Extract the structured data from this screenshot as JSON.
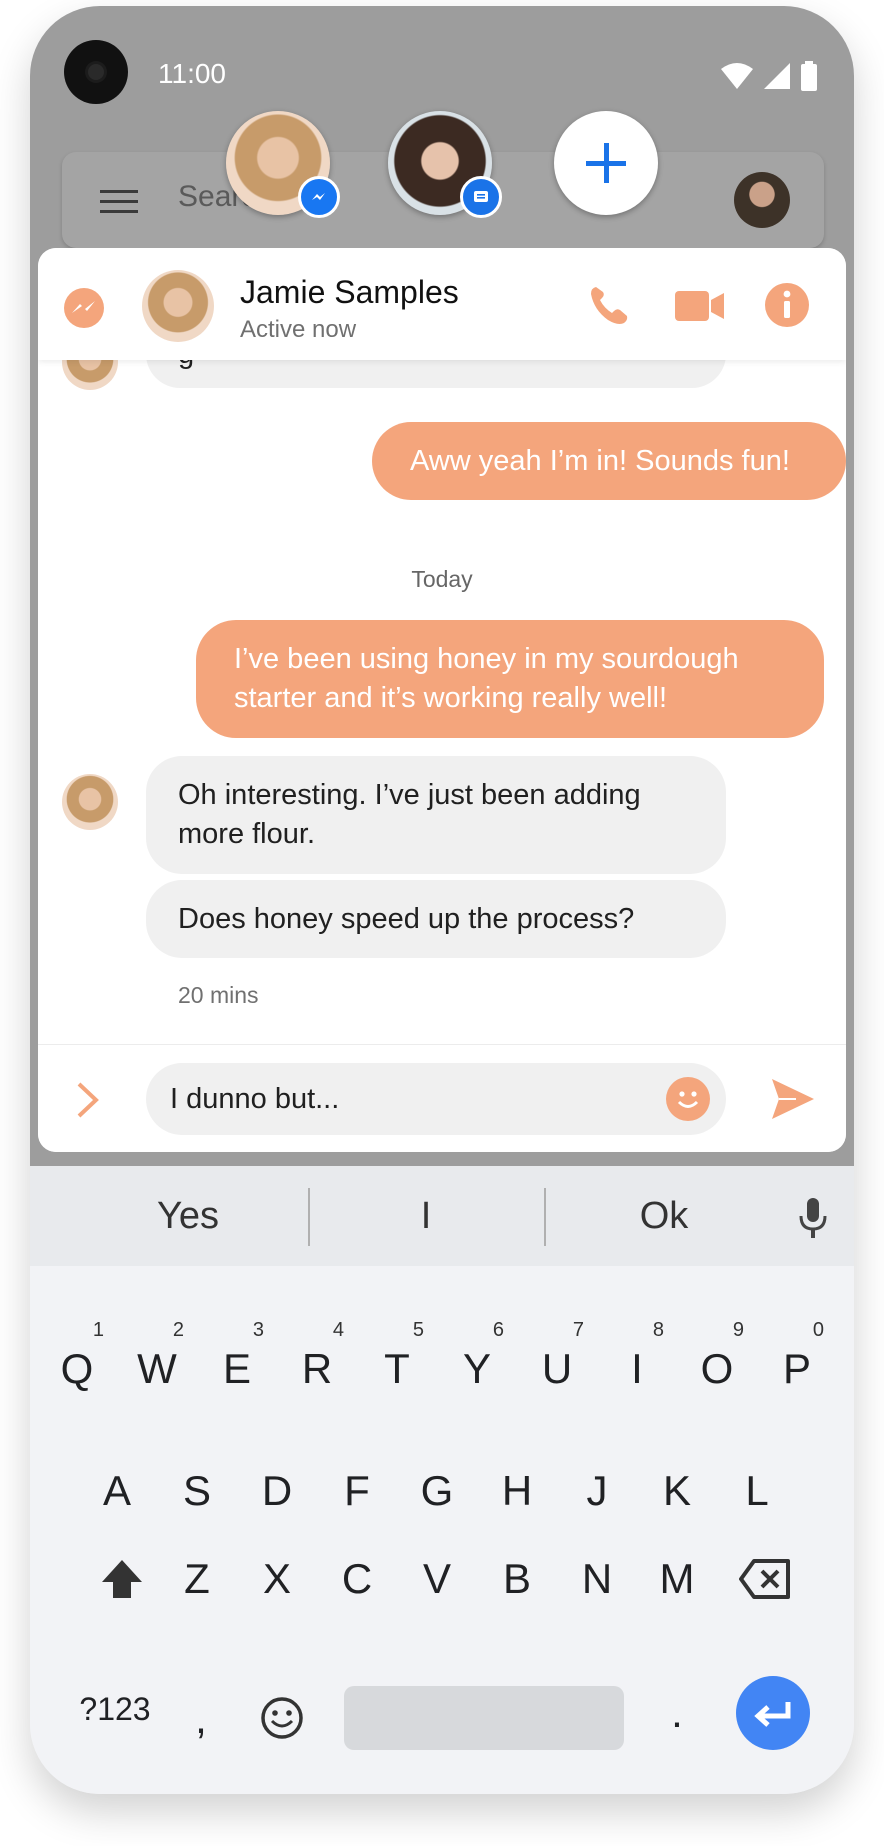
{
  "status_bar": {
    "time": "11:00"
  },
  "search": {
    "placeholder": "Search mail"
  },
  "chat_header": {
    "name": "Jamie Samples",
    "status": "Active now"
  },
  "messages": {
    "partial_incoming": "g",
    "outgoing_1": "Aww yeah I’m in! Sounds fun!",
    "date_divider": "Today",
    "outgoing_2_line1": "I’ve been using honey in my sourdough",
    "outgoing_2_line2": "starter and it’s working really well!",
    "incoming_1_line1": "Oh interesting. I’ve just been adding",
    "incoming_1_line2": "more flour.",
    "incoming_2": "Does honey speed up the process?",
    "timestamp": "20 mins"
  },
  "composer": {
    "value": "I dunno but..."
  },
  "suggestions": [
    "Yes",
    "I",
    "Ok"
  ],
  "keyboard": {
    "row1": [
      "Q",
      "W",
      "E",
      "R",
      "T",
      "Y",
      "U",
      "I",
      "O",
      "P"
    ],
    "row1_nums": [
      "1",
      "2",
      "3",
      "4",
      "5",
      "6",
      "7",
      "8",
      "9",
      "0"
    ],
    "row2": [
      "A",
      "S",
      "D",
      "F",
      "G",
      "H",
      "J",
      "K",
      "L"
    ],
    "row3": [
      "Z",
      "X",
      "C",
      "V",
      "B",
      "N",
      "M"
    ],
    "symbols": "?123",
    "comma": ",",
    "period": "."
  },
  "colors": {
    "accent": "#f4a57c",
    "dim_overlay": "#9d9d9d",
    "bubble_in": "#f0f0f0",
    "enter_key": "#4285f4",
    "messenger": "#1877f2"
  },
  "icons": [
    "messenger-icon",
    "phone-icon",
    "video-icon",
    "info-icon",
    "chevron-right-icon",
    "emoji-icon",
    "send-icon",
    "mic-icon",
    "shift-icon",
    "backspace-icon",
    "enter-icon",
    "menu-icon",
    "wifi-icon",
    "signal-icon",
    "battery-icon",
    "plus-icon"
  ]
}
